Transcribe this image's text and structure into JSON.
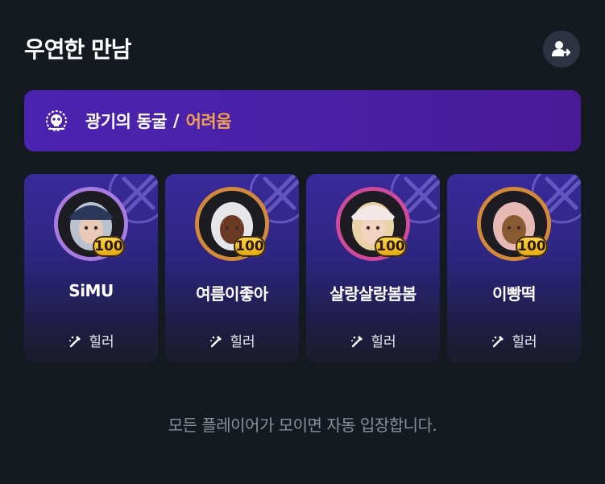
{
  "header": {
    "title": "우연한 만남",
    "action_icon": "user-switch-icon"
  },
  "dungeon": {
    "icon": "dungeon-skull-icon",
    "name": "광기의 동굴",
    "separator": "/",
    "difficulty": "어려움",
    "difficulty_color": "#f0a050"
  },
  "players": [
    {
      "name": "SiMU",
      "level": "100",
      "role": "힐러",
      "ring": "#a77be0",
      "hair": "#b9c1cf",
      "skin": "#e9c9b8",
      "hat": "#2b3a5c"
    },
    {
      "name": "여름이좋아",
      "level": "100",
      "role": "힐러",
      "ring": "#d28a3a",
      "hair": "#e6e6ea",
      "skin": "#6b3a24",
      "hat": ""
    },
    {
      "name": "살랑살랑봄봄",
      "level": "100",
      "role": "힐러",
      "ring": "#d04a9c",
      "hair": "#e9d2a8",
      "skin": "#f2d3c2",
      "hat": "#f3e8e8"
    },
    {
      "name": "이빵떡",
      "level": "100",
      "role": "힐러",
      "ring": "#d28a3a",
      "hair": "#e7b9b5",
      "skin": "#8a5a34",
      "hat": ""
    }
  ],
  "footer": {
    "message": "모든 플레이어가 모이면 자동 입장합니다."
  }
}
